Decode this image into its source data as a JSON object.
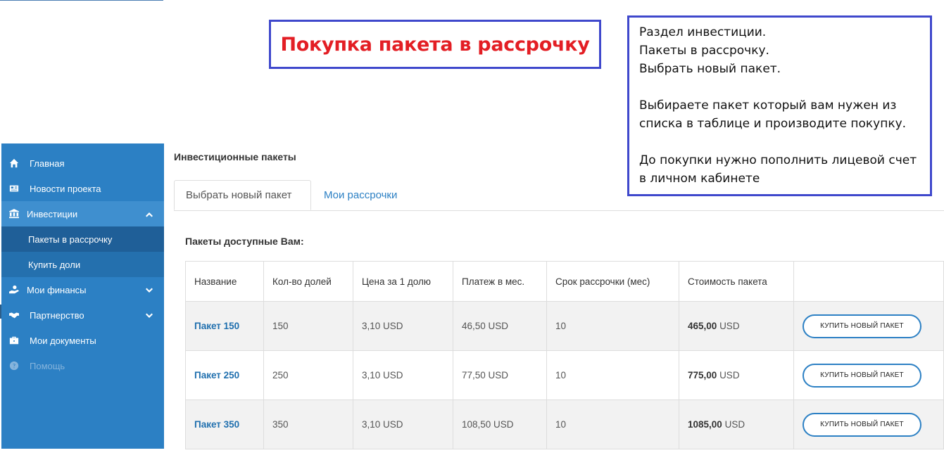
{
  "annotation": {
    "title": "Покупка пакета в рассрочку",
    "note": {
      "block1": "Раздел инвестиции.\nПакеты в рассрочку.\nВыбрать новый пакет.",
      "block2": "Выбираете пакет который вам нужен из\nсписка в таблице и производите покупку.",
      "block3": "До покупки нужно пополнить лицевой счет\nв личном кабинете"
    }
  },
  "sidebar": {
    "items": [
      {
        "label": "Главная",
        "icon": "home-icon"
      },
      {
        "label": "Новости проекта",
        "icon": "newspaper-icon"
      },
      {
        "label": "Инвестиции",
        "icon": "bank-icon",
        "expanded": true
      },
      {
        "label": "Пакеты в рассрочку",
        "active": true
      },
      {
        "label": "Купить доли"
      },
      {
        "label": "Мои финансы",
        "icon": "hand-money-icon"
      },
      {
        "label": "Партнерство",
        "icon": "handshake-icon"
      },
      {
        "label": "Мои документы",
        "icon": "briefcase-icon"
      },
      {
        "label": "Помощь",
        "icon": "question-icon",
        "disabled": true
      }
    ]
  },
  "main": {
    "section_title": "Инвестиционные пакеты",
    "tabs": [
      {
        "label": "Выбрать новый пакет",
        "active": true
      },
      {
        "label": "Мои рассрочки"
      }
    ],
    "subheading": "Пакеты доступные Вам:",
    "table": {
      "headers": [
        "Название",
        "Кол-во долей",
        "Цена за 1 долю",
        "Платеж в мес.",
        "Срок рассрочки (мес)",
        "Стоимость пакета",
        ""
      ],
      "rows": [
        {
          "name": "Пакет 150",
          "shares": "150",
          "price": "3,10 USD",
          "monthly": "46,50 USD",
          "term": "10",
          "cost": "465,00",
          "currency": "USD",
          "button": "Купить новый пакет"
        },
        {
          "name": "Пакет 250",
          "shares": "250",
          "price": "3,10 USD",
          "monthly": "77,50 USD",
          "term": "10",
          "cost": "775,00",
          "currency": "USD",
          "button": "Купить новый пакет"
        },
        {
          "name": "Пакет 350",
          "shares": "350",
          "price": "3,10 USD",
          "monthly": "108,50 USD",
          "term": "10",
          "cost": "1085,00",
          "currency": "USD",
          "button": "Купить новый пакет"
        }
      ]
    }
  },
  "colors": {
    "sidebar": "#2c80c4",
    "annotation_border": "#3f48cc",
    "annotation_title": "#e31e24",
    "link": "#1f6fae"
  }
}
